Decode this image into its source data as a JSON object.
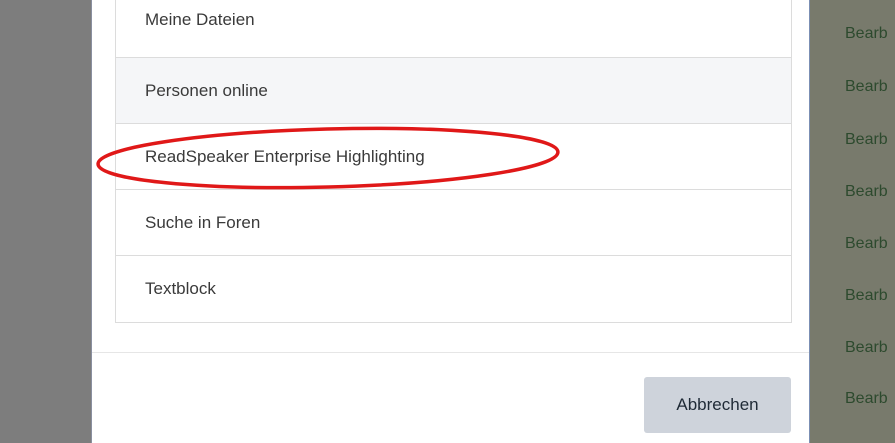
{
  "modal": {
    "items": [
      {
        "label": "Meine Dateien"
      },
      {
        "label": "Personen online"
      },
      {
        "label": "ReadSpeaker Enterprise Highlighting"
      },
      {
        "label": "Suche in Foren"
      },
      {
        "label": "Textblock"
      }
    ],
    "cancel_label": "Abbrechen"
  },
  "background": {
    "links": [
      "Bearb",
      "Bearb",
      "Bearb",
      "Bearb",
      "Bearb",
      "Bearb",
      "Bearb",
      "Bearb"
    ]
  },
  "annotation": {
    "color": "#e01818",
    "target": "ReadSpeaker Enterprise Highlighting"
  }
}
